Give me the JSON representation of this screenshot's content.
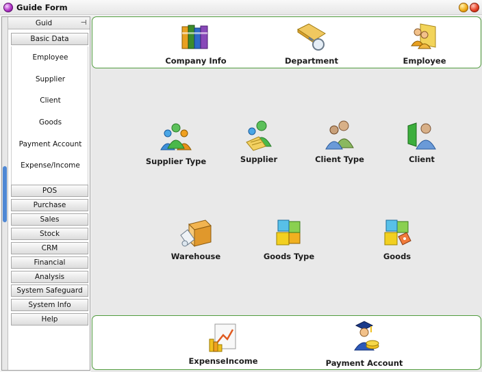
{
  "window": {
    "title": "Guide Form"
  },
  "nav": {
    "header": "Guid",
    "basic_data_label": "Basic Data",
    "basic_items": [
      "Employee",
      "Supplier",
      "Client",
      "Goods",
      "Payment Account",
      "Expense/Income"
    ],
    "sections": [
      "POS",
      "Purchase",
      "Sales",
      "Stock",
      "CRM",
      "Financial",
      "Analysis",
      "System Safeguard",
      "System Info",
      "Help"
    ]
  },
  "top_group": {
    "items": [
      {
        "label": "Company Info",
        "icon": "books-icon"
      },
      {
        "label": "Department",
        "icon": "folder-magnifier-icon"
      },
      {
        "label": "Employee",
        "icon": "employees-folder-icon"
      }
    ]
  },
  "middle": {
    "row1": [
      {
        "label": "Supplier Type",
        "icon": "user-group-icon"
      },
      {
        "label": "Supplier",
        "icon": "supplier-icon"
      },
      {
        "label": "Client Type",
        "icon": "client-group-icon"
      },
      {
        "label": "Client",
        "icon": "client-icon"
      }
    ],
    "row2": [
      {
        "label": "Warehouse",
        "icon": "warehouse-box-icon"
      },
      {
        "label": "Goods Type",
        "icon": "goods-cubes-icon"
      },
      {
        "label": "Goods",
        "icon": "goods-icon"
      }
    ]
  },
  "bottom_group": {
    "items": [
      {
        "label": "ExpenseIncome",
        "icon": "expense-chart-icon"
      },
      {
        "label": "Payment Account",
        "icon": "payment-account-icon"
      }
    ]
  }
}
